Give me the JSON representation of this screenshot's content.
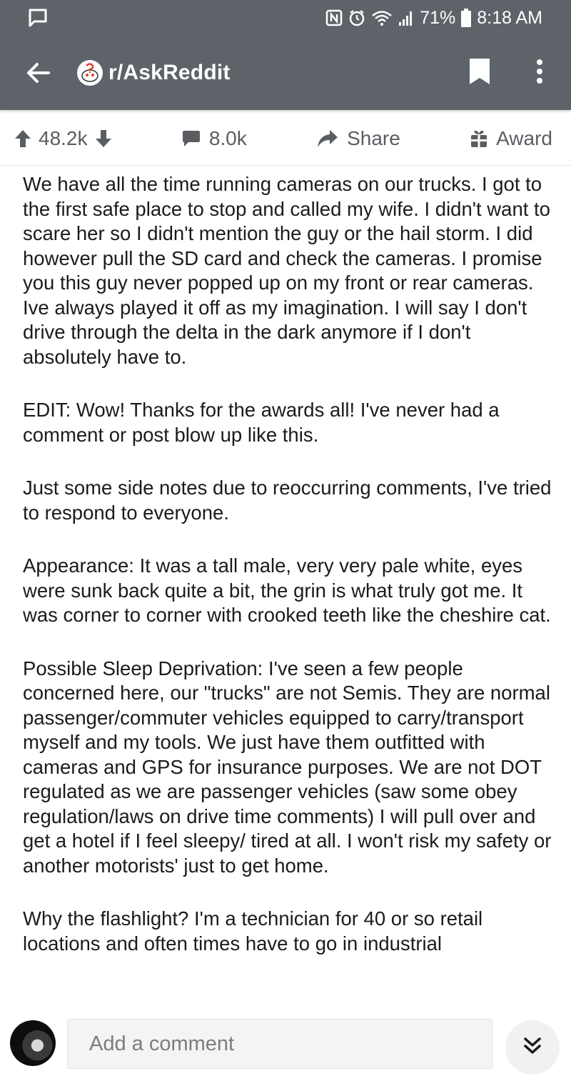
{
  "status_bar": {
    "battery": "71%",
    "time": "8:18 AM",
    "icons": [
      "message-icon",
      "nfc-icon",
      "alarm-icon",
      "wifi-icon",
      "signal-icon",
      "battery-icon"
    ]
  },
  "app_bar": {
    "subreddit": "r/AskReddit",
    "icons": [
      "back-arrow-icon",
      "subreddit-icon",
      "bookmark-icon",
      "more-vertical-icon"
    ]
  },
  "actions": {
    "score": "48.2k",
    "comments": "8.0k",
    "share": "Share",
    "award": "Award",
    "icons": [
      "upvote-icon",
      "downvote-icon",
      "comment-icon",
      "share-icon",
      "award-icon"
    ]
  },
  "comment": {
    "paragraphs": [
      "We have all the time running cameras on our trucks. I got to the first safe place to stop and called my wife. I didn't want to scare her so I didn't mention the guy or the hail storm. I did however pull the SD card and check the cameras. I promise you this guy never popped up on my front or rear cameras. Ive always played it off as my imagination. I will say I don't drive through the delta in the dark anymore if I don't absolutely have to.",
      "EDIT: Wow! Thanks for the awards all! I've never had a comment or post blow up like this.",
      "Just some side notes due to reoccurring comments, I've tried to respond to everyone.",
      "Appearance: It was a tall male, very very pale white, eyes were sunk back quite a bit, the grin is what truly got me. It was corner to corner with crooked teeth like the cheshire cat.",
      "Possible Sleep Deprivation: I've seen a few people concerned here, our \"trucks\" are not Semis. They are normal passenger/commuter vehicles equipped to carry/transport myself and my tools. We just have them outfitted with cameras and GPS for insurance purposes. We are not DOT regulated as we are passenger vehicles (saw some obey regulation/laws on drive time comments) I will pull over and get a hotel if I feel sleepy/ tired at all. I won't risk my safety or another motorists' just to get home.",
      "Why the flashlight? I'm a technician for 40 or so retail locations and often times have to go in industrial"
    ]
  },
  "bottom_bar": {
    "comment_placeholder": "Add a comment",
    "icons": [
      "user-avatar",
      "double-chevron-down-icon"
    ]
  },
  "colors": {
    "header_bg": "#5d6369",
    "action_gray": "#5a5e62",
    "text": "#1b1b1b",
    "input_bg": "#f4f4f5"
  }
}
